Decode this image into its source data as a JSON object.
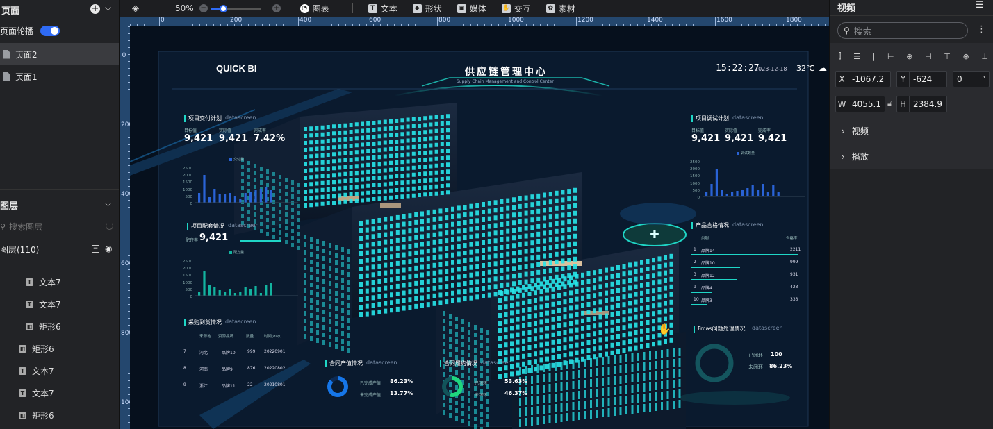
{
  "left_panel": {
    "pages_title": "页面",
    "carousel_label": "页面轮播",
    "pages": [
      "页面2",
      "页面1"
    ],
    "layers_title": "图层",
    "layer_search_placeholder": "搜索图层",
    "layer_group_label": "图层(110)",
    "layers": [
      {
        "type": "text",
        "label": "文本7",
        "indent": true
      },
      {
        "type": "text",
        "label": "文本7",
        "indent": true
      },
      {
        "type": "rect",
        "label": "矩形6",
        "indent": true
      },
      {
        "type": "rect",
        "label": "矩形6",
        "indent": false
      },
      {
        "type": "text",
        "label": "文本7",
        "indent": false
      },
      {
        "type": "text",
        "label": "文本7",
        "indent": false
      },
      {
        "type": "rect",
        "label": "矩形6",
        "indent": false
      }
    ]
  },
  "toolbar": {
    "zoom": "50%",
    "items": [
      {
        "icon": "chart-pie-icon",
        "label": "图表"
      },
      {
        "icon": "text-t-icon",
        "label": "文本"
      },
      {
        "icon": "shape-icon",
        "label": "形状"
      },
      {
        "icon": "media-image-icon",
        "label": "媒体"
      },
      {
        "icon": "interaction-icon",
        "label": "交互"
      },
      {
        "icon": "palette-icon",
        "label": "素材"
      }
    ]
  },
  "ruler": {
    "h_labels": [
      "0",
      "200",
      "400",
      "600",
      "800",
      "1000",
      "1200",
      "1400",
      "1600",
      "1800"
    ],
    "v_labels": [
      "0",
      "200",
      "400",
      "600",
      "800",
      "1000"
    ]
  },
  "right_panel": {
    "title": "视频",
    "search_placeholder": "搜索",
    "x_label": "X",
    "x_value": "-1067.2",
    "y_label": "Y",
    "y_value": "-624",
    "rot_value": "0",
    "rot_unit": "°",
    "w_label": "W",
    "w_value": "4055.1",
    "h_label": "H",
    "h_value": "2384.9",
    "sections": [
      "视频",
      "播放"
    ]
  },
  "dashboard": {
    "brand": "QUICK BI",
    "title": "供应链管理中心",
    "subtitle": "Supply Chain Management and Control Center",
    "time": "15:22:27",
    "date": "2023-12-18",
    "temp": "32℃",
    "suffix": "datascreen",
    "delivery": {
      "title": "项目交付计划",
      "labels": [
        "目标值",
        "实际值",
        "完成率"
      ],
      "values": [
        "9,421",
        "9,421",
        "7.42%"
      ],
      "legend": "交付量"
    },
    "matching": {
      "title": "项目配套情况",
      "label": "配齐率",
      "value": "9,421",
      "legend": "配方量"
    },
    "purchase": {
      "title": "采购到货情况",
      "headers": [
        "来源地",
        "资源品牌",
        "数量",
        "时间(day)"
      ],
      "rows": [
        [
          "7",
          "河北",
          "品牌10",
          "999",
          "20220901"
        ],
        [
          "8",
          "河南",
          "品牌9",
          "876",
          "20220802"
        ],
        [
          "9",
          "浙江",
          "品牌11",
          "22",
          "20210801"
        ]
      ]
    },
    "debug": {
      "title": "项目调试计划",
      "labels": [
        "目标值",
        "实际值",
        "完成率"
      ],
      "values": [
        "9,421",
        "9,421",
        "9,421"
      ],
      "legend": "调试数量"
    },
    "quality": {
      "title": "产品合格情况",
      "headers": [
        "类别",
        "合格率"
      ],
      "rows": [
        [
          "1",
          "品牌14",
          "2211"
        ],
        [
          "2",
          "品牌10",
          "999"
        ],
        [
          "3",
          "品牌12",
          "931"
        ],
        [
          "9",
          "品牌4",
          "423"
        ],
        [
          "10",
          "品牌3",
          "333"
        ]
      ]
    },
    "issues": {
      "title": "Frcas问题处理情况",
      "closed_label": "已闭环",
      "closed_value": "100",
      "open_label": "未闭环",
      "open_value": "86.23%"
    },
    "output": {
      "title": "合同产值情况",
      "a_label": "已完成产值",
      "a_value": "86.23%",
      "b_label": "未完成产值",
      "b_value": "13.77%"
    },
    "fulfil": {
      "title": "合同履约情况",
      "a_label": "已闭环",
      "a_value": "53.63%",
      "b_label": "未闭环",
      "b_value": "46.37%"
    },
    "yticks": [
      "2500",
      "2000",
      "1500",
      "1000",
      "500",
      "0"
    ]
  }
}
